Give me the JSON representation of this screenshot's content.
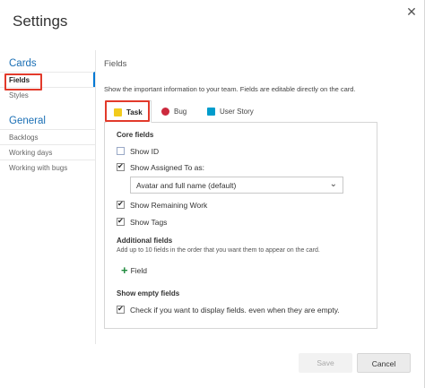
{
  "dialog": {
    "title": "Settings"
  },
  "sidebar": {
    "groups": [
      {
        "heading": "Cards",
        "items": [
          {
            "label": "Fields",
            "selected": true
          },
          {
            "label": "Styles"
          }
        ]
      },
      {
        "heading": "General",
        "items": [
          {
            "label": "Backlogs"
          },
          {
            "label": "Working days"
          },
          {
            "label": "Working with bugs"
          }
        ]
      }
    ]
  },
  "main": {
    "heading": "Fields",
    "description": "Show the important information to your team. Fields are editable directly on the card.",
    "tabs": [
      {
        "label": "Task",
        "icon": "task-icon",
        "color": "#f2cb1d",
        "active": true
      },
      {
        "label": "Bug",
        "icon": "bug-icon",
        "color": "#cc293d"
      },
      {
        "label": "User Story",
        "icon": "user-story-icon",
        "color": "#009ccc"
      }
    ],
    "core_fields": {
      "label": "Core fields",
      "show_id": {
        "label": "Show ID",
        "checked": false
      },
      "show_assigned": {
        "label": "Show Assigned To as:",
        "checked": true
      },
      "assigned_select": {
        "value": "Avatar and full name (default)"
      },
      "show_remaining": {
        "label": "Show Remaining Work",
        "checked": true
      },
      "show_tags": {
        "label": "Show Tags",
        "checked": true
      }
    },
    "additional_fields": {
      "label": "Additional fields",
      "description": "Add up to 10 fields in the order that you want them to appear on the card.",
      "add_label": "Field"
    },
    "empty_fields": {
      "label": "Show empty fields",
      "check": {
        "label": "Check if you want to display fields. even when they are empty.",
        "checked": true
      }
    }
  },
  "footer": {
    "save_label": "Save",
    "cancel_label": "Cancel"
  },
  "colors": {
    "accent": "#0078d4",
    "highlight": "#e23a2b",
    "add": "#1e8a3c"
  }
}
